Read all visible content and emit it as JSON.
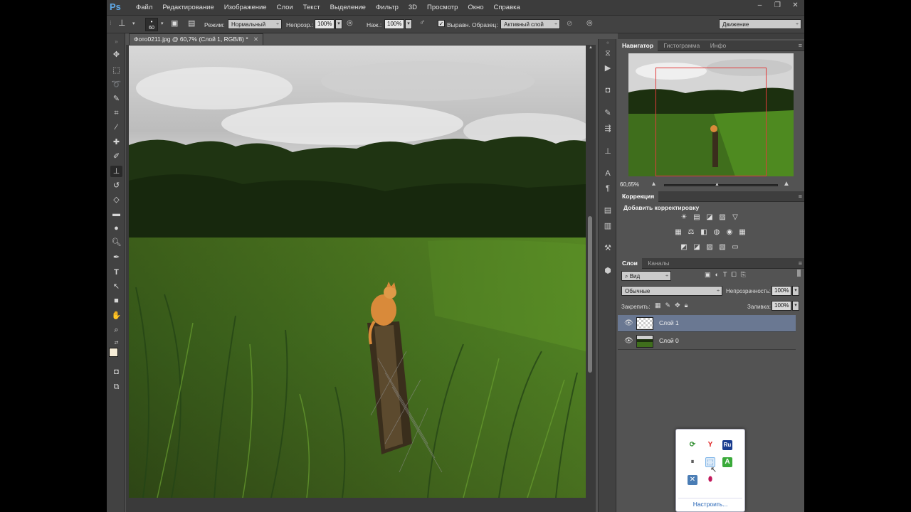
{
  "app": {
    "logo": "Ps"
  },
  "menu": [
    "Файл",
    "Редактирование",
    "Изображение",
    "Слои",
    "Текст",
    "Выделение",
    "Фильтр",
    "3D",
    "Просмотр",
    "Окно",
    "Справка"
  ],
  "window_controls": [
    "‒",
    "❐",
    "✕"
  ],
  "options": {
    "brush_size": "60",
    "mode_label": "Режим:",
    "mode_value": "Нормальный",
    "opacity_label": "Непрозр.:",
    "opacity_value": "100%",
    "flow_label": "Наж.:",
    "flow_value": "100%",
    "aligned_label": "Выравн.",
    "sample_label": "Образец:",
    "sample_value": "Активный слой",
    "workspace": "Движение"
  },
  "document": {
    "tab": "Фото0211.jpg @ 60,7% (Слой 1, RGB/8) *"
  },
  "navigator": {
    "tabs": [
      "Навигатор",
      "Гистограмма",
      "Инфо"
    ],
    "zoom": "60,65%",
    "view_rect_color": "#e23b3b"
  },
  "adjustments": {
    "tab": "Коррекция",
    "title": "Добавить корректировку",
    "row1": [
      "☀",
      "▤",
      "◪",
      "▨",
      "▽"
    ],
    "row2": [
      "▦",
      "⚖",
      "◧",
      "◍",
      "◉",
      "▦"
    ],
    "row3": [
      "◩",
      "◪",
      "▨",
      "▧",
      "▭"
    ]
  },
  "layers": {
    "tabs": [
      "Слои",
      "Каналы"
    ],
    "filter": "Вид",
    "blend_mode": "Обычные",
    "opacity_label": "Непрозрачность:",
    "opacity_value": "100%",
    "lock_label": "Закрепить:",
    "fill_label": "Заливка:",
    "fill_value": "100%",
    "items": [
      {
        "name": "Слой 1",
        "selected": true
      },
      {
        "name": "Слой 0",
        "selected": false
      }
    ]
  },
  "tray_popup": {
    "customize": "Настроить..."
  },
  "colors": {
    "accent_selected_layer": "#6a7892",
    "menubar": "#3c3c3c",
    "panel": "#535353"
  }
}
